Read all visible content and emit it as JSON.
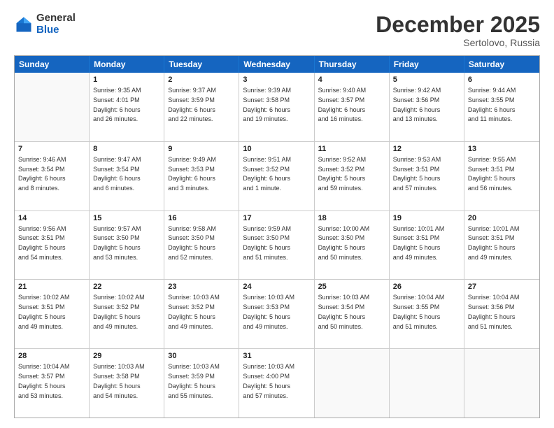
{
  "logo": {
    "general": "General",
    "blue": "Blue"
  },
  "header": {
    "month": "December 2025",
    "location": "Sertolovo, Russia"
  },
  "days": [
    "Sunday",
    "Monday",
    "Tuesday",
    "Wednesday",
    "Thursday",
    "Friday",
    "Saturday"
  ],
  "weeks": [
    [
      {
        "day": "",
        "content": ""
      },
      {
        "day": "1",
        "content": "Sunrise: 9:35 AM\nSunset: 4:01 PM\nDaylight: 6 hours\nand 26 minutes."
      },
      {
        "day": "2",
        "content": "Sunrise: 9:37 AM\nSunset: 3:59 PM\nDaylight: 6 hours\nand 22 minutes."
      },
      {
        "day": "3",
        "content": "Sunrise: 9:39 AM\nSunset: 3:58 PM\nDaylight: 6 hours\nand 19 minutes."
      },
      {
        "day": "4",
        "content": "Sunrise: 9:40 AM\nSunset: 3:57 PM\nDaylight: 6 hours\nand 16 minutes."
      },
      {
        "day": "5",
        "content": "Sunrise: 9:42 AM\nSunset: 3:56 PM\nDaylight: 6 hours\nand 13 minutes."
      },
      {
        "day": "6",
        "content": "Sunrise: 9:44 AM\nSunset: 3:55 PM\nDaylight: 6 hours\nand 11 minutes."
      }
    ],
    [
      {
        "day": "7",
        "content": "Sunrise: 9:46 AM\nSunset: 3:54 PM\nDaylight: 6 hours\nand 8 minutes."
      },
      {
        "day": "8",
        "content": "Sunrise: 9:47 AM\nSunset: 3:54 PM\nDaylight: 6 hours\nand 6 minutes."
      },
      {
        "day": "9",
        "content": "Sunrise: 9:49 AM\nSunset: 3:53 PM\nDaylight: 6 hours\nand 3 minutes."
      },
      {
        "day": "10",
        "content": "Sunrise: 9:51 AM\nSunset: 3:52 PM\nDaylight: 6 hours\nand 1 minute."
      },
      {
        "day": "11",
        "content": "Sunrise: 9:52 AM\nSunset: 3:52 PM\nDaylight: 5 hours\nand 59 minutes."
      },
      {
        "day": "12",
        "content": "Sunrise: 9:53 AM\nSunset: 3:51 PM\nDaylight: 5 hours\nand 57 minutes."
      },
      {
        "day": "13",
        "content": "Sunrise: 9:55 AM\nSunset: 3:51 PM\nDaylight: 5 hours\nand 56 minutes."
      }
    ],
    [
      {
        "day": "14",
        "content": "Sunrise: 9:56 AM\nSunset: 3:51 PM\nDaylight: 5 hours\nand 54 minutes."
      },
      {
        "day": "15",
        "content": "Sunrise: 9:57 AM\nSunset: 3:50 PM\nDaylight: 5 hours\nand 53 minutes."
      },
      {
        "day": "16",
        "content": "Sunrise: 9:58 AM\nSunset: 3:50 PM\nDaylight: 5 hours\nand 52 minutes."
      },
      {
        "day": "17",
        "content": "Sunrise: 9:59 AM\nSunset: 3:50 PM\nDaylight: 5 hours\nand 51 minutes."
      },
      {
        "day": "18",
        "content": "Sunrise: 10:00 AM\nSunset: 3:50 PM\nDaylight: 5 hours\nand 50 minutes."
      },
      {
        "day": "19",
        "content": "Sunrise: 10:01 AM\nSunset: 3:51 PM\nDaylight: 5 hours\nand 49 minutes."
      },
      {
        "day": "20",
        "content": "Sunrise: 10:01 AM\nSunset: 3:51 PM\nDaylight: 5 hours\nand 49 minutes."
      }
    ],
    [
      {
        "day": "21",
        "content": "Sunrise: 10:02 AM\nSunset: 3:51 PM\nDaylight: 5 hours\nand 49 minutes."
      },
      {
        "day": "22",
        "content": "Sunrise: 10:02 AM\nSunset: 3:52 PM\nDaylight: 5 hours\nand 49 minutes."
      },
      {
        "day": "23",
        "content": "Sunrise: 10:03 AM\nSunset: 3:52 PM\nDaylight: 5 hours\nand 49 minutes."
      },
      {
        "day": "24",
        "content": "Sunrise: 10:03 AM\nSunset: 3:53 PM\nDaylight: 5 hours\nand 49 minutes."
      },
      {
        "day": "25",
        "content": "Sunrise: 10:03 AM\nSunset: 3:54 PM\nDaylight: 5 hours\nand 50 minutes."
      },
      {
        "day": "26",
        "content": "Sunrise: 10:04 AM\nSunset: 3:55 PM\nDaylight: 5 hours\nand 51 minutes."
      },
      {
        "day": "27",
        "content": "Sunrise: 10:04 AM\nSunset: 3:56 PM\nDaylight: 5 hours\nand 51 minutes."
      }
    ],
    [
      {
        "day": "28",
        "content": "Sunrise: 10:04 AM\nSunset: 3:57 PM\nDaylight: 5 hours\nand 53 minutes."
      },
      {
        "day": "29",
        "content": "Sunrise: 10:03 AM\nSunset: 3:58 PM\nDaylight: 5 hours\nand 54 minutes."
      },
      {
        "day": "30",
        "content": "Sunrise: 10:03 AM\nSunset: 3:59 PM\nDaylight: 5 hours\nand 55 minutes."
      },
      {
        "day": "31",
        "content": "Sunrise: 10:03 AM\nSunset: 4:00 PM\nDaylight: 5 hours\nand 57 minutes."
      },
      {
        "day": "",
        "content": ""
      },
      {
        "day": "",
        "content": ""
      },
      {
        "day": "",
        "content": ""
      }
    ]
  ]
}
